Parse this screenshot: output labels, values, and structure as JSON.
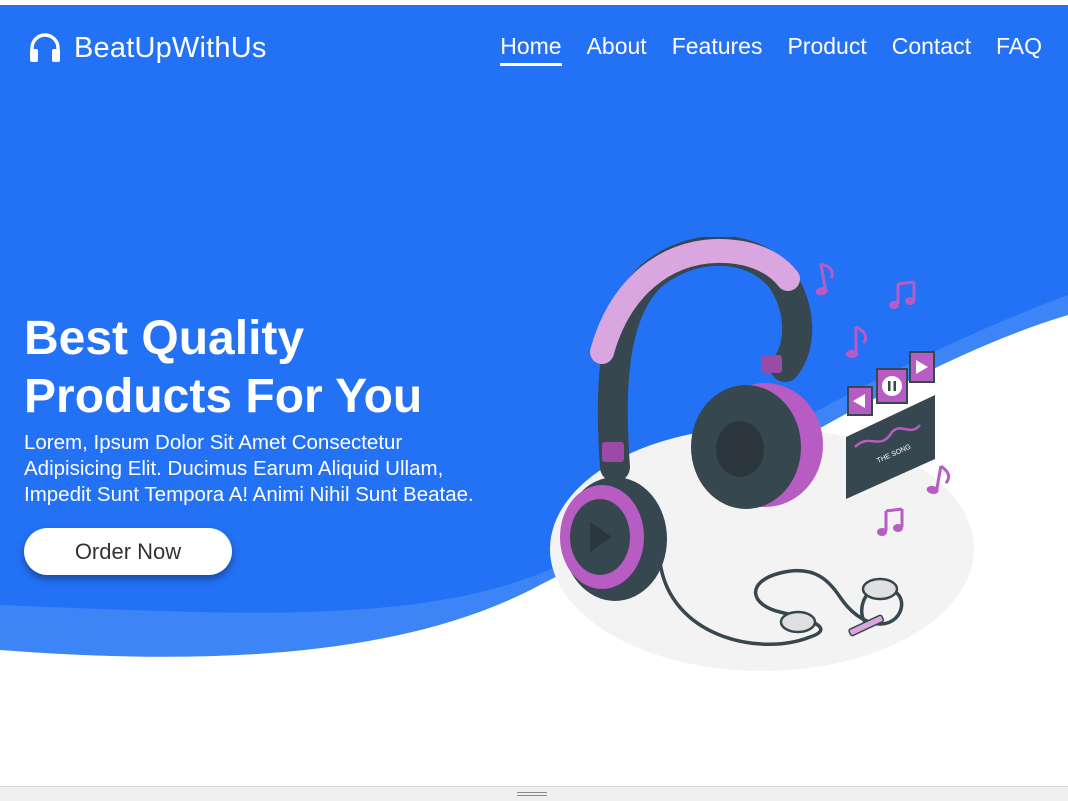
{
  "brand": {
    "name": "BeatUpWithUs",
    "icon": "headphones-icon"
  },
  "nav": {
    "items": [
      {
        "label": "Home",
        "active": true
      },
      {
        "label": "About"
      },
      {
        "label": "Features"
      },
      {
        "label": "Product"
      },
      {
        "label": "Contact"
      },
      {
        "label": "FAQ"
      }
    ]
  },
  "hero": {
    "title_line1": "Best Quality",
    "title_line2": "Products For You",
    "desc_line1": "Lorem, Ipsum Dolor Sit Amet Consectetur",
    "desc_line2": "Adipisicing Elit. Ducimus Earum Aliquid Ullam,",
    "desc_line3": "Impedit Sunt Tempora A! Animi Nihil Sunt Beatae.",
    "cta_label": "Order Now"
  },
  "illustration": {
    "screen_text": "THE SONG"
  },
  "colors": {
    "primary": "#2371f5",
    "wave_light": "#3d84f7",
    "accent_purple": "#b65cc2",
    "accent_light_purple": "#d9a6e0",
    "dark_slate": "#37474f",
    "white": "#ffffff"
  }
}
